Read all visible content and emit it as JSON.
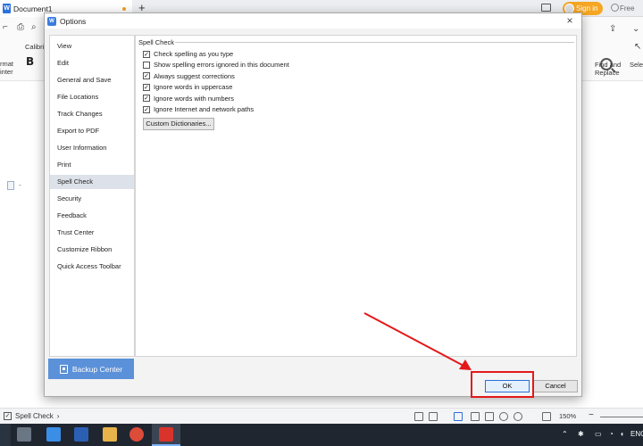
{
  "app": {
    "tab_label": "Document1",
    "new_tab": "+",
    "sign_in": "Sign in",
    "free_label": "Free",
    "font_name": "Calibri",
    "bold_label": "B",
    "format_painter_lines": [
      "rmat",
      "inter"
    ],
    "find_replace": [
      "Find and",
      "Replace"
    ],
    "select_label": "Selec",
    "page_dash": "-"
  },
  "dialog": {
    "title": "Options",
    "close_glyph": "×",
    "nav": [
      "View",
      "Edit",
      "General and Save",
      "File Locations",
      "Track Changes",
      "Export to PDF",
      "User Information",
      "Print",
      "Spell Check",
      "Security",
      "Feedback",
      "Trust Center",
      "Customize Ribbon",
      "Quick Access Toolbar"
    ],
    "active_nav": "Spell Check",
    "backup_label": "Backup Center",
    "section_title": "Spell Check",
    "options": [
      {
        "label": "Check spelling as you type",
        "checked": true
      },
      {
        "label": "Show spelling errors ignored in this document",
        "checked": false
      },
      {
        "label": "Always suggest corrections",
        "checked": true
      },
      {
        "label": "Ignore words in uppercase",
        "checked": true
      },
      {
        "label": "Ignore words with numbers",
        "checked": true
      },
      {
        "label": "Ignore Internet and network paths",
        "checked": true
      }
    ],
    "custom_dict_label": "Custom Dictionaries...",
    "ok_label": "OK",
    "cancel_label": "Cancel"
  },
  "status": {
    "spell_check": "Spell Check",
    "zoom": "150%",
    "zoom_minus": "−"
  },
  "taskbar": {
    "lang": "ENG"
  },
  "colors": {
    "accent_blue": "#5b91d9",
    "highlight_red": "#e3181b",
    "signin_orange": "#f5a623"
  },
  "icons": [
    "search-icon",
    "close-icon",
    "backup-icon",
    "checkbox-icon",
    "arrow-annotation"
  ]
}
